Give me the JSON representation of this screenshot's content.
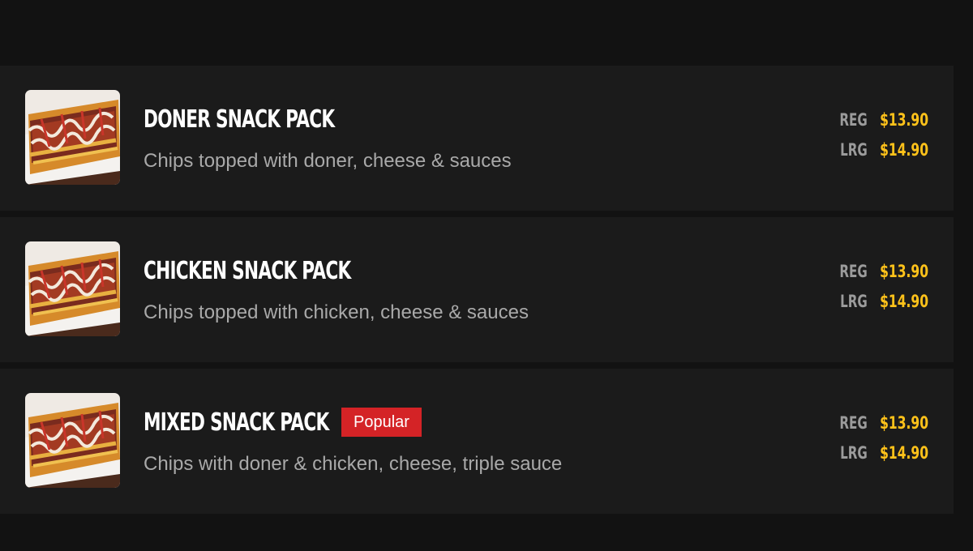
{
  "colors": {
    "page_background": "#121212",
    "card_background": "#1b1b1b",
    "title_color": "#ffffff",
    "description_color": "#a9a9a9",
    "price_label_color": "#9b9b9b",
    "price_value_color": "#ffc21a",
    "badge_background": "#d42326"
  },
  "items": [
    {
      "name": "DONER SNACK PACK",
      "description": "Chips topped with doner, cheese & sauces",
      "image_icon": "snack-pack-photo",
      "badge": "",
      "prices": [
        {
          "label": "REG",
          "value": "$13.90"
        },
        {
          "label": "LRG",
          "value": "$14.90"
        }
      ]
    },
    {
      "name": "CHICKEN SNACK PACK",
      "description": "Chips topped with chicken, cheese & sauces",
      "image_icon": "snack-pack-photo",
      "badge": "",
      "prices": [
        {
          "label": "REG",
          "value": "$13.90"
        },
        {
          "label": "LRG",
          "value": "$14.90"
        }
      ]
    },
    {
      "name": "MIXED SNACK PACK",
      "description": "Chips with doner & chicken, cheese, triple sauce",
      "image_icon": "snack-pack-photo",
      "badge": "Popular",
      "prices": [
        {
          "label": "REG",
          "value": "$13.90"
        },
        {
          "label": "LRG",
          "value": "$14.90"
        }
      ]
    }
  ]
}
